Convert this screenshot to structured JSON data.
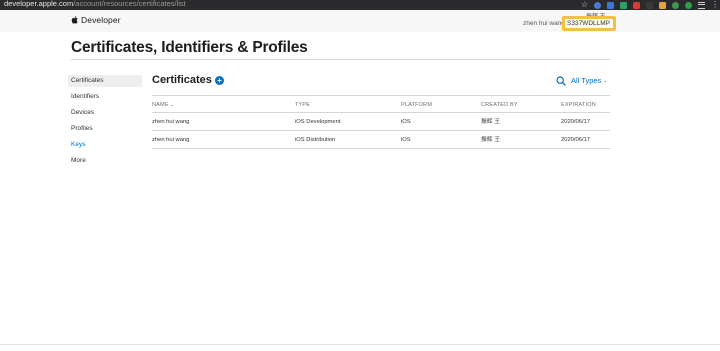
{
  "browser": {
    "url_domain": "developer.apple.com",
    "url_path": "/account/resources/certificates/list",
    "extensions": [
      {
        "name": "star-icon"
      },
      {
        "name": "extension-1",
        "color": "#4a7bd0"
      },
      {
        "name": "extension-2",
        "color": "#3a78d8"
      },
      {
        "name": "extension-3",
        "color": "#2aa06b"
      },
      {
        "name": "extension-4",
        "color": "#d93b35"
      },
      {
        "name": "extension-5",
        "color": "#3a3a3a"
      },
      {
        "name": "extension-6",
        "color": "#e8a33c"
      },
      {
        "name": "extension-7",
        "color": "#3c9a48"
      },
      {
        "name": "extension-8",
        "color": "#27a148"
      },
      {
        "name": "extension-9",
        "color": "#c9c9c9"
      },
      {
        "name": "extension-10",
        "color": "#c9c9c9"
      }
    ]
  },
  "header": {
    "brand": "Developer",
    "user_name": "zhen hui wang",
    "overlay_name": "振辉 王",
    "team_id": "S337WDLLMP"
  },
  "page_title": "Certificates, Identifiers & Profiles",
  "sidebar": {
    "items": [
      {
        "label": "Certificates"
      },
      {
        "label": "Identifiers"
      },
      {
        "label": "Devices"
      },
      {
        "label": "Profiles"
      },
      {
        "label": "Keys"
      },
      {
        "label": "More"
      }
    ]
  },
  "main": {
    "section_title": "Certificates",
    "add_icon": "+",
    "filter_label": "All Types",
    "columns": [
      "NAME",
      "TYPE",
      "PLATFORM",
      "CREATED BY",
      "EXPIRATION"
    ],
    "sort_indicator": "⌄",
    "rows": [
      [
        "zhen hui wang",
        "iOS Development",
        "iOS",
        "振辉 王",
        "2020/06/17"
      ],
      [
        "zhen hui wang",
        "iOS Distribution",
        "iOS",
        "振辉 王",
        "2020/06/17"
      ]
    ]
  },
  "colors": {
    "accent": "#0070c9",
    "highlight_box": "#f4c043"
  }
}
